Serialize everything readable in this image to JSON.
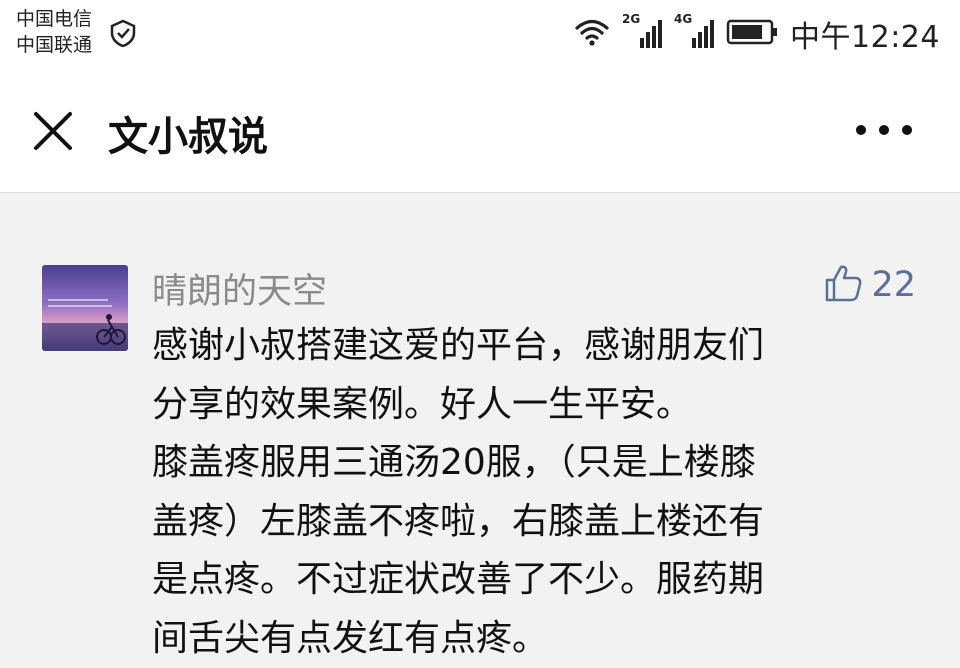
{
  "status_bar": {
    "carrier_1": "中国电信",
    "carrier_2": "中国联通",
    "net_1": "2G",
    "net_2": "4G",
    "time": "中午12:24",
    "icons": [
      "shield-check-icon",
      "wifi-icon",
      "signal-2g-icon",
      "signal-4g-icon",
      "battery-icon"
    ]
  },
  "header": {
    "title": "文小叔说",
    "close_icon": "close-icon",
    "more_icon": "more-icon"
  },
  "comment": {
    "username": "晴朗的天空",
    "likes": "22",
    "text_lines": [
      "感谢小叔搭建这爱的平台，感谢朋友们",
      "分享的效果案例。好人一生平安。",
      "膝盖疼服用三通汤20服，（只是上楼膝",
      "盖疼）左膝盖不疼啦，右膝盖上楼还有",
      "是点疼。不过症状改善了不少。服药期",
      "间舌尖有点发红有点疼。"
    ]
  },
  "colors": {
    "background": "#f2f2f2",
    "bar": "#ffffff",
    "username": "#8a8a8a",
    "like": "#5c6f99"
  }
}
